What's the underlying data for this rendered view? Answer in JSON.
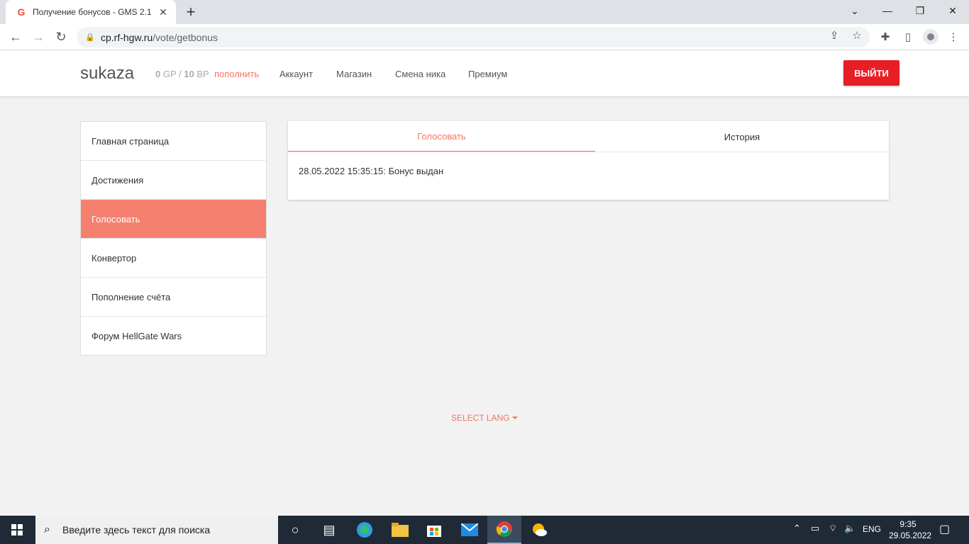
{
  "browser": {
    "tab_title": "Получение бонусов - GMS 2.1",
    "url_host": "cp.rf-hgw.ru",
    "url_path": "/vote/getbonus"
  },
  "header": {
    "brand": "sukaza",
    "gp_value": "0",
    "gp_unit": "GP",
    "bp_value": "10",
    "bp_unit": "BP",
    "topup_label": "пополнить",
    "nav": [
      "Аккаунт",
      "Магазин",
      "Смена ника",
      "Премиум"
    ],
    "logout_label": "ВЫЙТИ"
  },
  "sidebar": {
    "items": [
      {
        "label": "Главная страница",
        "active": false
      },
      {
        "label": "Достижения",
        "active": false
      },
      {
        "label": "Голосовать",
        "active": true
      },
      {
        "label": "Конвертор",
        "active": false
      },
      {
        "label": "Пополнение счёта",
        "active": false
      },
      {
        "label": "Форум HellGate Wars",
        "active": false
      }
    ]
  },
  "main": {
    "tabs": [
      "Голосовать",
      "История"
    ],
    "message": "28.05.2022 15:35:15: Бонус выдан"
  },
  "footer": {
    "select_lang": "SELECT LANG"
  },
  "taskbar": {
    "search_placeholder": "Введите здесь текст для поиска",
    "lang": "ENG",
    "time": "9:35",
    "date": "29.05.2022"
  },
  "colors": {
    "accent": "#f3755f",
    "active_sidebar": "#f58070",
    "logout": "#e81e26"
  }
}
